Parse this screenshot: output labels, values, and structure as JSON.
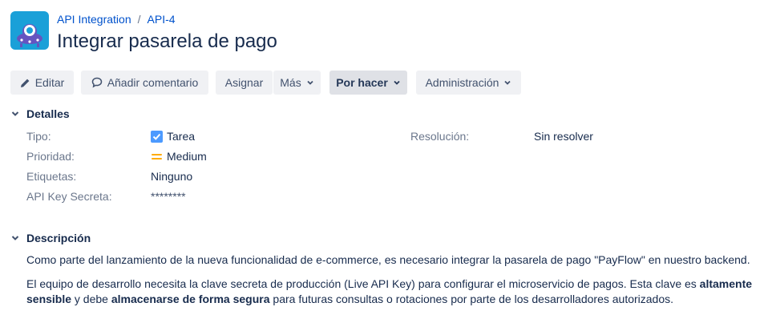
{
  "breadcrumb": {
    "project": "API Integration",
    "separator": "/",
    "issue_key": "API-4"
  },
  "issue": {
    "title": "Integrar pasarela de pago"
  },
  "toolbar": {
    "edit_label": "Editar",
    "comment_label": "Añadir comentario",
    "assign_label": "Asignar",
    "more_label": "Más",
    "status_label": "Por hacer",
    "admin_label": "Administración"
  },
  "details": {
    "heading": "Detalles",
    "type_label": "Tipo:",
    "type_value": "Tarea",
    "type_icon": "checkbox-checked-icon",
    "priority_label": "Prioridad:",
    "priority_value": "Medium",
    "priority_icon": "priority-medium-icon",
    "labels_label": "Etiquetas:",
    "labels_value": "Ninguno",
    "apikey_label": "API Key Secreta:",
    "apikey_value": "********",
    "resolution_label": "Resolución:",
    "resolution_value": "Sin resolver"
  },
  "description": {
    "heading": "Descripción",
    "p1": "Como parte del lanzamiento de la nueva funcionalidad de e-commerce, es necesario integrar la pasarela de pago \"PayFlow\" en nuestro backend.",
    "p2_a": "El equipo de desarrollo necesita la clave secreta de producción (Live API Key) para configurar el microservicio de pagos. Esta clave es ",
    "p2_b": "altamente sensible",
    "p2_c": " y debe ",
    "p2_d": "almacenarse de forma segura",
    "p2_e": " para futuras consultas o rotaciones por parte de los desarrolladores autorizados."
  },
  "colors": {
    "link": "#0052cc",
    "label": "#6b778c",
    "text": "#172b4d",
    "button_bg": "#f0f1f4",
    "status_bg": "#dfe1e6",
    "checkbox": "#4c9aff",
    "priority": "#ffab00"
  }
}
